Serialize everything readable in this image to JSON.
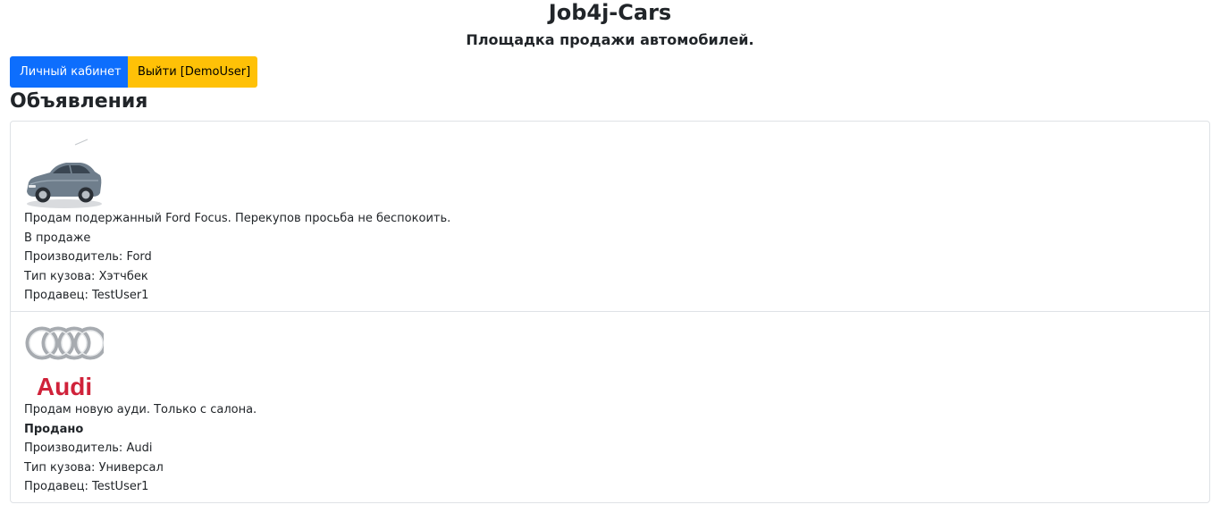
{
  "header": {
    "title": "Job4j-Cars",
    "subtitle": "Площадка продажи автомобилей."
  },
  "toolbar": {
    "cabinet_label": "Личный кабинет",
    "logout_label": "Выйти [DemoUser]"
  },
  "section": {
    "title": "Объявления"
  },
  "listings": [
    {
      "image_icon": "car-photo",
      "description": "Продам подержанный Ford Focus. Перекупов просьба не беспокоить.",
      "status": "В продаже",
      "manufacturer": "Производитель: Ford",
      "body_type": "Тип кузова: Хэтчбек",
      "seller": "Продавец: TestUser1"
    },
    {
      "image_icon": "audi-logo",
      "logo_text": "Audi",
      "description": "Продам новую ауди. Только с салона.",
      "status": "Продано",
      "manufacturer": "Производитель: Audi",
      "body_type": "Тип кузова: Универсал",
      "seller": "Продавец: TestUser1"
    }
  ],
  "colors": {
    "primary": "#0d6efd",
    "warning": "#ffc107",
    "border": "#dfe2e6",
    "text": "#212529",
    "audi_red": "#d0223a"
  }
}
